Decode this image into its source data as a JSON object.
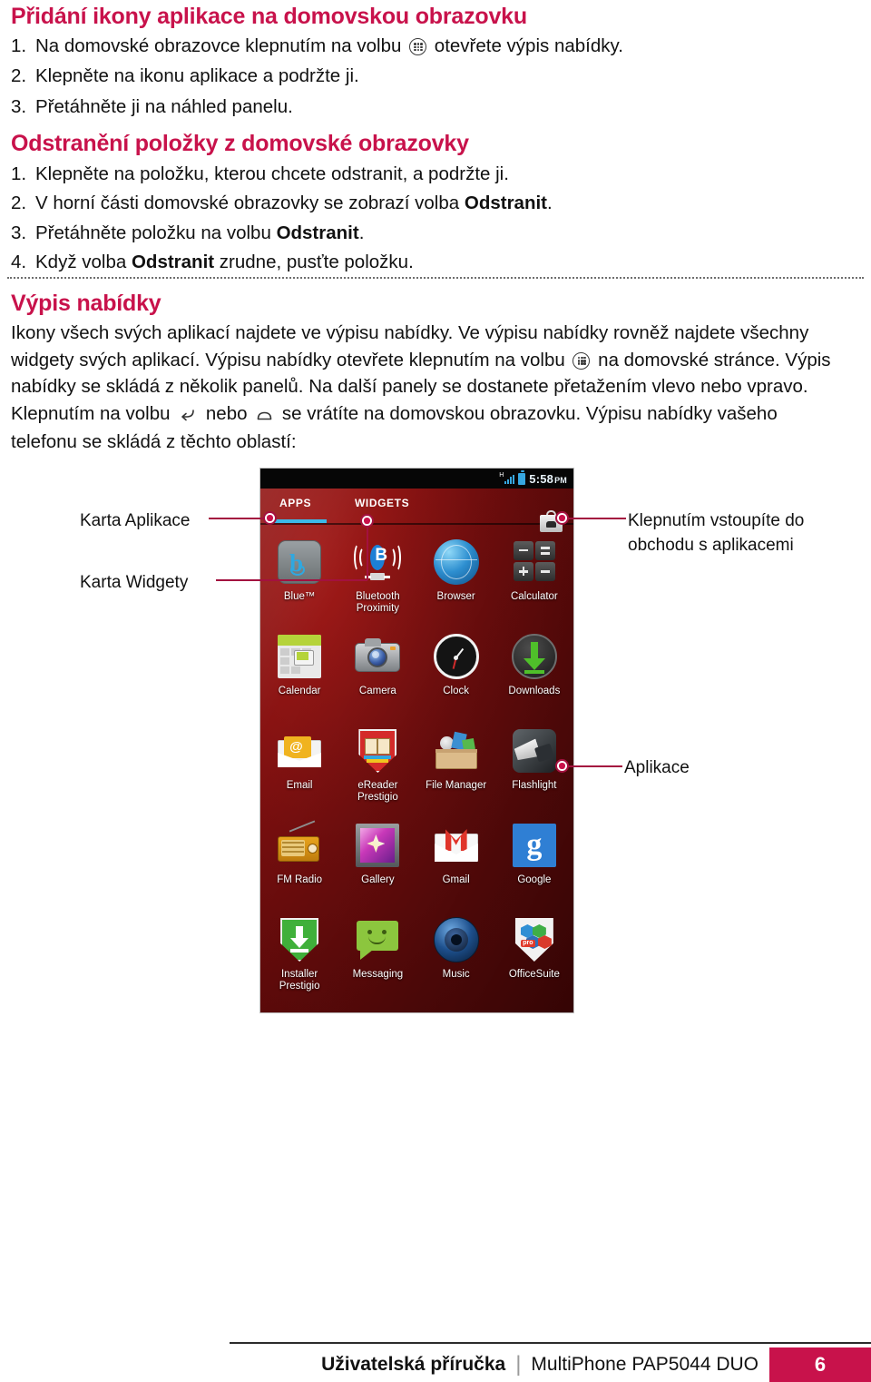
{
  "sections": [
    {
      "title": "Přidání ikony aplikace na domovskou obrazovku",
      "steps": [
        {
          "num": "1.",
          "pre": "Na domovské obrazovce klepnutím na volbu ",
          "icon": "apps-drawer-icon",
          "post": " otevřete výpis nabídky."
        },
        {
          "num": "2.",
          "pre": "Klepněte na ikonu aplikace a podržte ji.",
          "icon": "",
          "post": ""
        },
        {
          "num": "3.",
          "pre": "Přetáhněte ji na náhled panelu.",
          "icon": "",
          "post": ""
        }
      ]
    },
    {
      "title": "Odstranění položky z domovské obrazovky",
      "steps": [
        {
          "num": "1.",
          "pre": "Klepněte na položku, kterou chcete odstranit, a podržte ji.",
          "icon": "",
          "post": ""
        },
        {
          "num": "2.",
          "pre": "V horní části domovské obrazovky se zobrazí volba ",
          "bold": "Odstranit",
          "post": "."
        },
        {
          "num": "3.",
          "pre": "Přetáhněte položku na volbu ",
          "bold": "Odstranit",
          "post": "."
        },
        {
          "num": "4.",
          "pre": "Když volba ",
          "bold": "Odstranit",
          "post": " zrudne, pusťte položku."
        }
      ]
    }
  ],
  "menu_section": {
    "title": "Výpis nabídky",
    "para_part1": "Ikony všech svých aplikací najdete ve výpisu nabídky. Ve výpisu nabídky rovněž najdete všechny widgety svých aplikací. Výpisu nabídky otevřete klepnutím na volbu ",
    "para_part2": " na domovské stránce. Výpis nabídky se skládá z několik panelů. Na další panely se dostanete přetažením vlevo nebo vpravo. Klepnutím na volbu ",
    "para_part3": " nebo ",
    "para_part4": " se vrátíte na domovskou obrazovku. Výpisu nabídky vašeho telefonu se skládá z těchto oblastí:"
  },
  "phone": {
    "status": {
      "network_letter": "H",
      "time": "5:58",
      "ampm": "PM",
      "signal_icon": "signal-bars-icon",
      "battery_icon": "battery-icon"
    },
    "tabs": [
      {
        "label": "APPS",
        "selected": true
      },
      {
        "label": "WIDGETS",
        "selected": false
      }
    ],
    "market_icon": "play-store-bag-icon",
    "apps": [
      {
        "label": "Blue™",
        "icon": "blue-app-icon"
      },
      {
        "label": "Bluetooth Proximity",
        "icon": "bluetooth-proximity-icon"
      },
      {
        "label": "Browser",
        "icon": "browser-globe-icon"
      },
      {
        "label": "Calculator",
        "icon": "calculator-icon"
      },
      {
        "label": "Calendar",
        "icon": "calendar-icon"
      },
      {
        "label": "Camera",
        "icon": "camera-icon"
      },
      {
        "label": "Clock",
        "icon": "clock-icon"
      },
      {
        "label": "Downloads",
        "icon": "downloads-arrow-icon"
      },
      {
        "label": "Email",
        "icon": "email-envelope-icon"
      },
      {
        "label": "eReader Prestigio",
        "icon": "ereader-shield-icon"
      },
      {
        "label": "File Manager",
        "icon": "file-manager-box-icon"
      },
      {
        "label": "Flashlight",
        "icon": "flashlight-icon"
      },
      {
        "label": "FM Radio",
        "icon": "fm-radio-icon"
      },
      {
        "label": "Gallery",
        "icon": "gallery-photo-icon"
      },
      {
        "label": "Gmail",
        "icon": "gmail-envelope-icon"
      },
      {
        "label": "Google",
        "icon": "google-g-icon"
      },
      {
        "label": "Installer Prestigio",
        "icon": "installer-shield-icon"
      },
      {
        "label": "Messaging",
        "icon": "messaging-bubble-icon"
      },
      {
        "label": "Music",
        "icon": "music-speaker-icon"
      },
      {
        "label": "OfficeSuite",
        "icon": "officesuite-shield-icon"
      }
    ]
  },
  "callouts": {
    "apps_tab": "Karta Aplikace",
    "widgets_tab": "Karta Widgety",
    "store": "Klepnutím vstoupíte do obchodu s aplikacemi",
    "apps": "Aplikace"
  },
  "footer": {
    "bold": "Uživatelská příručka",
    "separator": "|",
    "product": "MultiPhone PAP5044 DUO",
    "page": "6",
    "accent": "#C8124B"
  }
}
